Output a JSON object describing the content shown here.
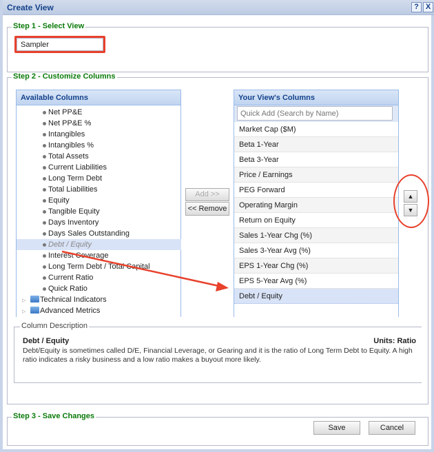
{
  "window": {
    "title": "Create View",
    "help": "?",
    "close": "X"
  },
  "step1": {
    "legend": "Step 1 - Select View",
    "view_name": "Sampler"
  },
  "step2": {
    "legend": "Step 2 - Customize Columns",
    "available": {
      "header": "Available Columns",
      "items": [
        "Net PP&E",
        "Net PP&E %",
        "Intangibles",
        "Intangibles %",
        "Total Assets",
        "Current Liabilities",
        "Long Term Debt",
        "Total Liabilities",
        "Equity",
        "Tangible Equity",
        "Days Inventory",
        "Days Sales Outstanding",
        "Debt / Equity",
        "Interest Coverage",
        "Long Term Debt / Total Capital",
        "Current Ratio",
        "Quick Ratio"
      ],
      "selected": "Debt / Equity",
      "folders": [
        "Technical Indicators",
        "Advanced Metrics"
      ]
    },
    "add_label": "Add >>",
    "remove_label": "<< Remove",
    "yours": {
      "header": "Your View's Columns",
      "quick_add_placeholder": "Quick Add (Search by Name)",
      "items": [
        "Market Cap ($M)",
        "Beta 1-Year",
        "Beta 3-Year",
        "Price / Earnings",
        "PEG Forward",
        "Operating Margin",
        "Return on Equity",
        "Sales 1-Year Chg (%)",
        "Sales 3-Year Avg (%)",
        "EPS 1-Year Chg (%)",
        "EPS 5-Year Avg (%)",
        "Debt / Equity"
      ],
      "selected": "Debt / Equity"
    },
    "description": {
      "legend": "Column Description",
      "name": "Debt / Equity",
      "units": "Units: Ratio",
      "text": "Debt/Equity is sometimes called D/E, Financial Leverage, or Gearing and it is the ratio of Long Term Debt to Equity. A high ratio indicates a risky business and a low ratio makes a buyout more likely."
    }
  },
  "step3": {
    "legend": "Step 3 - Save Changes",
    "save": "Save",
    "cancel": "Cancel"
  },
  "colors": {
    "legend": "#0a7a0a",
    "header": "#15428b",
    "annotation": "#e8412c",
    "selection": "#d9e3f7"
  }
}
